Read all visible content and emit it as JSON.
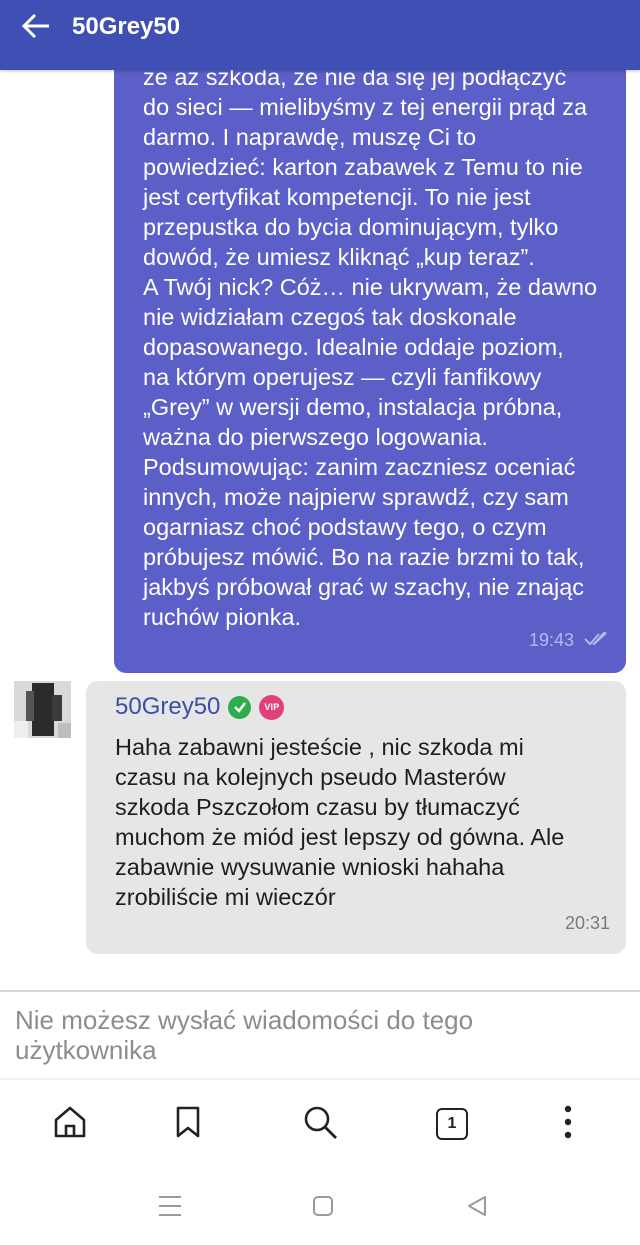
{
  "header": {
    "title": "50Grey50"
  },
  "outgoing_message": {
    "text": "że aż szkoda, że nie da się jej podłączyć\ndo sieci — mielibyśmy z tej energii prąd za\ndarmo. I naprawdę, muszę Ci to\npowiedzieć: karton zabawek z Temu to nie\njest certyfikat kompetencji. To nie jest\nprzepustka do bycia dominującym, tylko\ndowód, że umiesz kliknąć „kup teraz”.\nA Twój nick? Cóż… nie ukrywam, że dawno\nnie widziałam czegoś tak doskonale\ndopasowanego. Idealnie oddaje poziom,\nna którym operujesz — czyli fanfikowy\n„Grey” w wersji demo, instalacja próbna,\nważna do pierwszego logowania.\nPodsumowując: zanim zaczniesz oceniać\ninnych, może najpierw sprawdź, czy sam\nogarniasz choć podstawy tego, o czym\npróbujesz mówić. Bo na razie brzmi to tak,\njakbyś próbował grać w szachy, nie znając\nruchów pionka.",
    "time": "19:43",
    "read_icon": "double-check-icon"
  },
  "incoming_message": {
    "sender": "50Grey50",
    "verified_icon": "verified-check-icon",
    "vip_label": "VIP",
    "text": "Haha zabawni jesteście , nic szkoda mi\nczasu na kolejnych pseudo Masterów\nszkoda Pszczołom czasu by tłumaczyć\nmuchom że miód jest lepszy od gówna. Ale\nzabawnie wysuwanie wnioski hahaha\nzrobiliście mi wieczór",
    "time": "20:31"
  },
  "input_notice": "Nie możesz wysłać wiadomości do tego użytkownika",
  "bottom_nav": {
    "tab_count": "1",
    "items": [
      "home-icon",
      "bookmark-icon",
      "search-icon",
      "tabs-icon",
      "more-icon"
    ]
  },
  "colors": {
    "header": "#3f4fb3",
    "outgoing_bubble": "#5b5fc7",
    "incoming_bubble": "#e6e6e6",
    "sender_name": "#3b4fa8",
    "verified": "#2eae4b",
    "vip": "#e2407a"
  }
}
